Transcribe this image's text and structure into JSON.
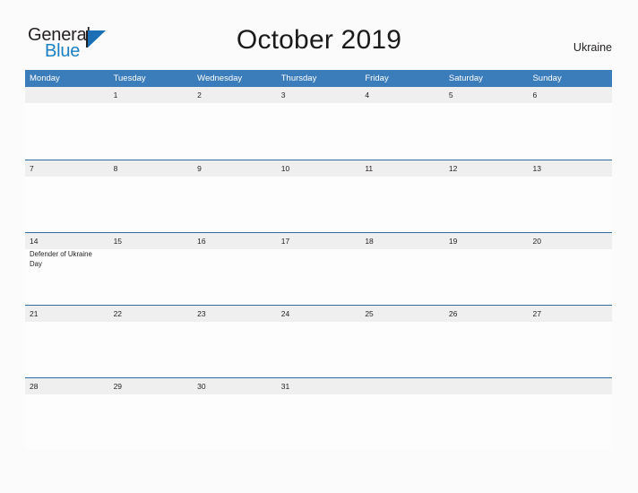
{
  "logo": {
    "word_one": "General",
    "word_two": "Blue",
    "mark": "triangle-flag-icon",
    "accent_color": "#1c7fc4"
  },
  "header": {
    "title": "October 2019",
    "country": "Ukraine",
    "header_color": "#3b7cba"
  },
  "calendar": {
    "weekdays": [
      "Monday",
      "Tuesday",
      "Wednesday",
      "Thursday",
      "Friday",
      "Saturday",
      "Sunday"
    ],
    "weeks": [
      [
        {
          "date": "",
          "event": ""
        },
        {
          "date": "1",
          "event": ""
        },
        {
          "date": "2",
          "event": ""
        },
        {
          "date": "3",
          "event": ""
        },
        {
          "date": "4",
          "event": ""
        },
        {
          "date": "5",
          "event": ""
        },
        {
          "date": "6",
          "event": ""
        }
      ],
      [
        {
          "date": "7",
          "event": ""
        },
        {
          "date": "8",
          "event": ""
        },
        {
          "date": "9",
          "event": ""
        },
        {
          "date": "10",
          "event": ""
        },
        {
          "date": "11",
          "event": ""
        },
        {
          "date": "12",
          "event": ""
        },
        {
          "date": "13",
          "event": ""
        }
      ],
      [
        {
          "date": "14",
          "event": "Defender of Ukraine Day"
        },
        {
          "date": "15",
          "event": ""
        },
        {
          "date": "16",
          "event": ""
        },
        {
          "date": "17",
          "event": ""
        },
        {
          "date": "18",
          "event": ""
        },
        {
          "date": "19",
          "event": ""
        },
        {
          "date": "20",
          "event": ""
        }
      ],
      [
        {
          "date": "21",
          "event": ""
        },
        {
          "date": "22",
          "event": ""
        },
        {
          "date": "23",
          "event": ""
        },
        {
          "date": "24",
          "event": ""
        },
        {
          "date": "25",
          "event": ""
        },
        {
          "date": "26",
          "event": ""
        },
        {
          "date": "27",
          "event": ""
        }
      ],
      [
        {
          "date": "28",
          "event": ""
        },
        {
          "date": "29",
          "event": ""
        },
        {
          "date": "30",
          "event": ""
        },
        {
          "date": "31",
          "event": ""
        },
        {
          "date": "",
          "event": ""
        },
        {
          "date": "",
          "event": ""
        },
        {
          "date": "",
          "event": ""
        }
      ]
    ]
  }
}
